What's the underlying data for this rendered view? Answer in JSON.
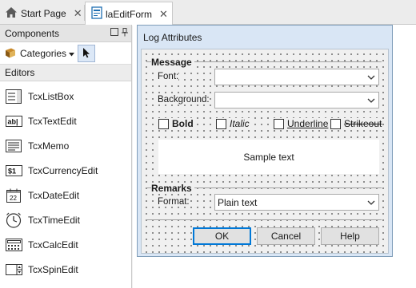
{
  "tabs": [
    {
      "label": "Start Page",
      "icon": "home-icon",
      "close": "✕"
    },
    {
      "label": "laEditForm",
      "icon": "form-file-icon",
      "close": "✕"
    }
  ],
  "components_panel": {
    "title": "Components",
    "categories_label": "Categories",
    "group": "Editors",
    "items": [
      {
        "label": "TcxListBox",
        "icon": "listbox-icon"
      },
      {
        "label": "TcxTextEdit",
        "icon": "textedit-icon",
        "icon_text": "ab|"
      },
      {
        "label": "TcxMemo",
        "icon": "memo-icon"
      },
      {
        "label": "TcxCurrencyEdit",
        "icon": "currency-icon",
        "icon_text": "$1"
      },
      {
        "label": "TcxDateEdit",
        "icon": "calendar-icon",
        "icon_text": "22"
      },
      {
        "label": "TcxTimeEdit",
        "icon": "clock-icon"
      },
      {
        "label": "TcxCalcEdit",
        "icon": "calculator-icon"
      },
      {
        "label": "TcxSpinEdit",
        "icon": "spinedit-icon"
      }
    ]
  },
  "form": {
    "title": "Log Attributes",
    "message_section": "Message",
    "font_label": "Font:",
    "font_value": "",
    "background_label": "Background:",
    "background_value": "",
    "checkboxes": [
      {
        "label": "Bold",
        "checked": false
      },
      {
        "label": "Italic",
        "checked": false
      },
      {
        "label": "Underline",
        "checked": false
      },
      {
        "label": "Strikeout",
        "checked": false
      }
    ],
    "sample_text": "Sample text",
    "remarks_section": "Remarks",
    "format_label": "Format:",
    "format_value": "Plain text",
    "buttons": {
      "ok": "OK",
      "cancel": "Cancel",
      "help": "Help"
    }
  },
  "colors": {
    "accent": "#0078d7",
    "form_caption": "#d9e6f5"
  }
}
